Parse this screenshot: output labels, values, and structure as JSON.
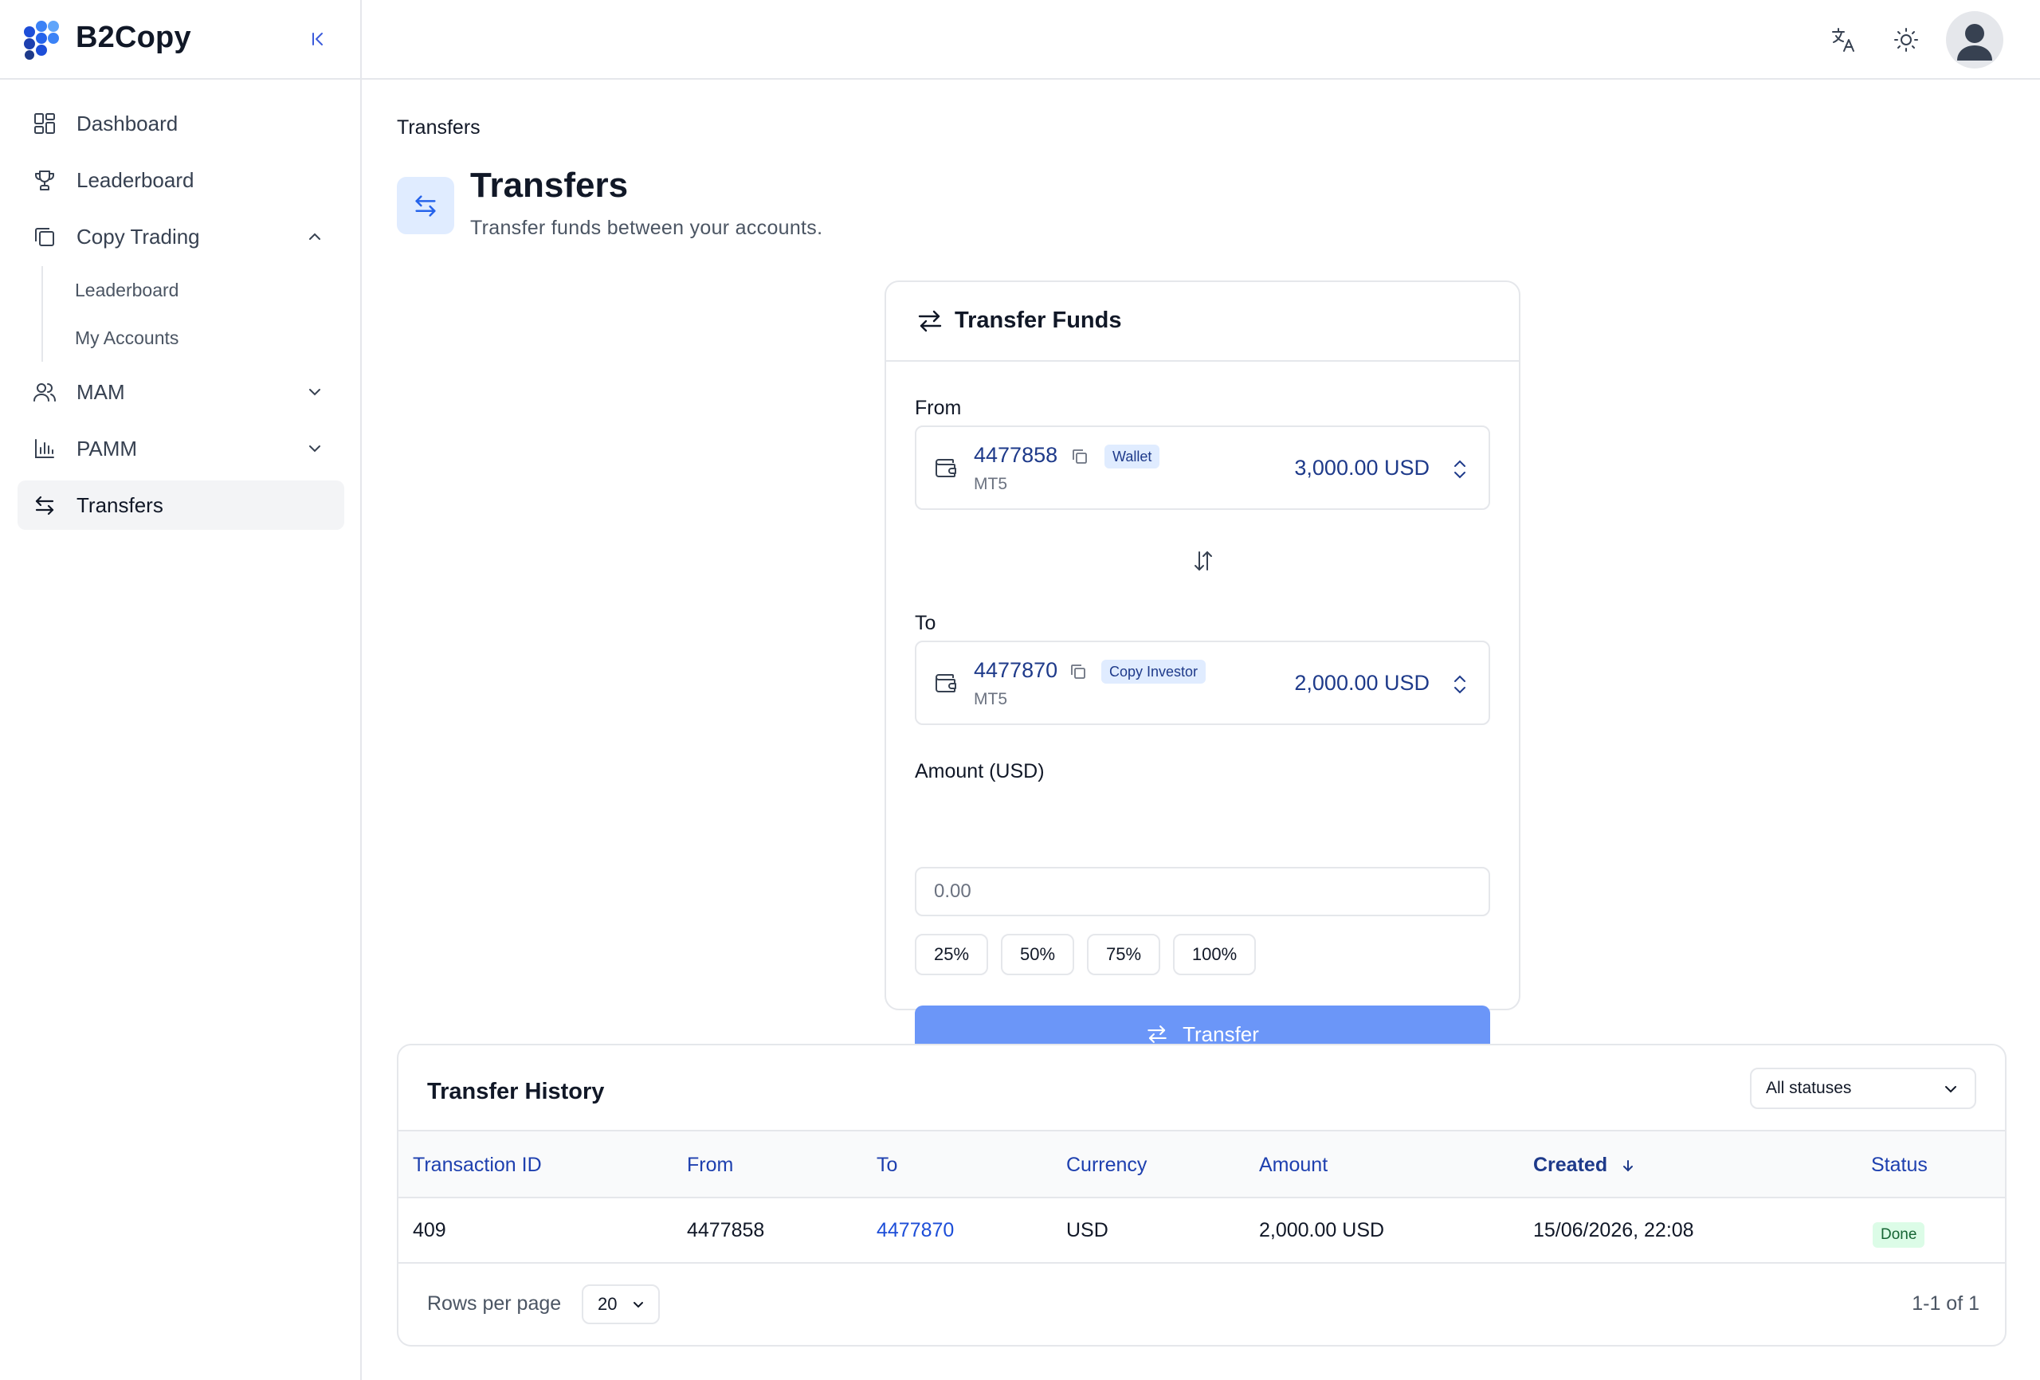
{
  "app": {
    "name": "B2Copy"
  },
  "sidebar": {
    "items": [
      {
        "label": "Dashboard",
        "icon": "dashboard-icon"
      },
      {
        "label": "Leaderboard",
        "icon": "trophy-icon"
      },
      {
        "label": "Copy Trading",
        "icon": "copy-icon",
        "expanded": true
      },
      {
        "label": "MAM",
        "icon": "users-icon",
        "expanded": false
      },
      {
        "label": "PAMM",
        "icon": "bar-chart-icon",
        "expanded": false
      },
      {
        "label": "Transfers",
        "icon": "transfer-icon",
        "active": true
      }
    ],
    "copy_trading_children": [
      {
        "label": "Leaderboard"
      },
      {
        "label": "My Accounts"
      }
    ]
  },
  "header": {
    "icons": [
      "translate-icon",
      "sun-icon",
      "user-avatar"
    ]
  },
  "page": {
    "breadcrumb": "Transfers",
    "title": "Transfers",
    "subtitle": "Transfer funds between your accounts."
  },
  "transfer_card": {
    "title": "Transfer Funds",
    "from_label": "From",
    "from": {
      "account": "4477858",
      "badge": "Wallet",
      "platform": "MT5",
      "balance": "3,000.00 USD"
    },
    "to_label": "To",
    "to": {
      "account": "4477870",
      "badge": "Copy Investor",
      "platform": "MT5",
      "balance": "2,000.00 USD"
    },
    "amount_label": "Amount (USD)",
    "amount_placeholder": "0.00",
    "amount_value": "",
    "percent_buttons": [
      "25%",
      "50%",
      "75%",
      "100%"
    ],
    "submit_label": "Transfer"
  },
  "history": {
    "title": "Transfer History",
    "status_filter": "All statuses",
    "columns": [
      "Transaction ID",
      "From",
      "To",
      "Currency",
      "Amount",
      "Created",
      "Status"
    ],
    "sorted_column": "Created",
    "sort_direction": "desc",
    "rows": [
      {
        "id": "409",
        "from": "4477858",
        "to": "4477870",
        "currency": "USD",
        "amount": "2,000.00 USD",
        "created": "15/06/2026, 22:08",
        "status": "Done"
      }
    ],
    "rows_per_page_label": "Rows per page",
    "rows_per_page": "20",
    "pagination": "1-1 of 1"
  },
  "colors": {
    "accent": "#2563eb",
    "link": "#1d4ed8",
    "primary_button": "#6b96f8",
    "done_badge_bg": "#dcfce7",
    "done_badge_text": "#166534"
  }
}
